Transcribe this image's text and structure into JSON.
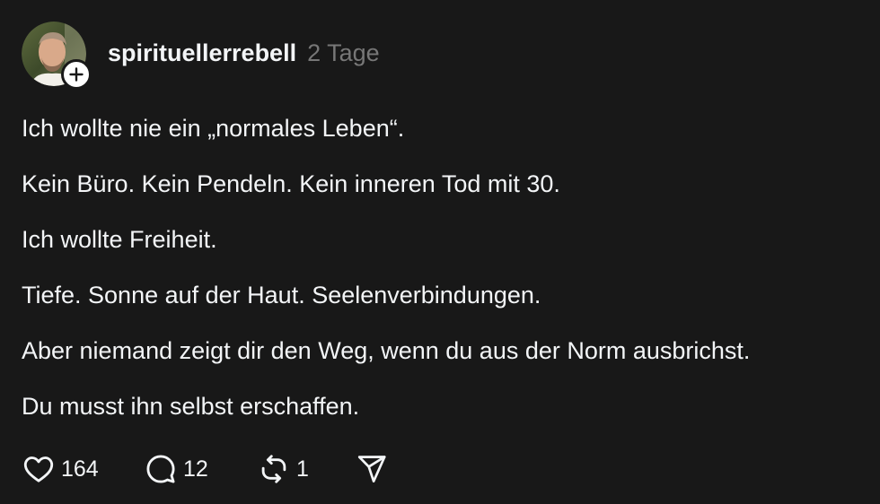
{
  "post": {
    "author": {
      "username": "spirituellerrebell",
      "follow_icon": "plus-icon"
    },
    "timestamp": "2 Tage",
    "lines": [
      "Ich wollte nie ein „normales Leben“.",
      "Kein Büro. Kein Pendeln. Kein inneren Tod mit 30.",
      "Ich wollte Freiheit.",
      "Tiefe. Sonne auf der Haut. Seelenverbindungen.",
      "Aber niemand zeigt dir den Weg, wenn du aus der Norm ausbrichst.",
      "Du musst ihn selbst erschaffen."
    ],
    "actions": {
      "likes": "164",
      "replies": "12",
      "reposts": "1"
    }
  },
  "colors": {
    "background": "#181818",
    "text": "#f3f5f7",
    "muted": "#777777"
  }
}
